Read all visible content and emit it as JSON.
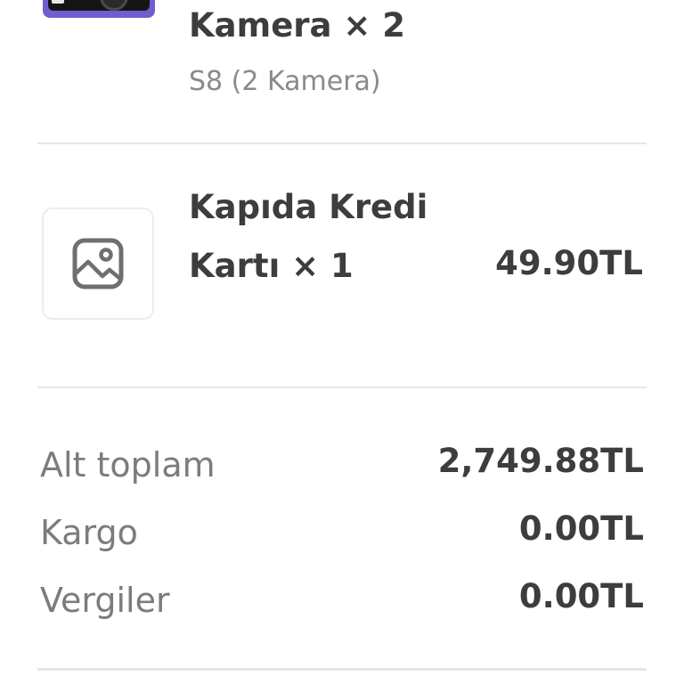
{
  "items": [
    {
      "name": "Kamera × 2",
      "variant": "S8 (2 Kamera)",
      "thumbnail_icon": "camera-product-photo"
    },
    {
      "name_line1": "Kapıda Kredi",
      "name_line2": "Kartı × 1",
      "price": "49.90TL",
      "thumbnail_icon": "image-placeholder-icon"
    }
  ],
  "totals": {
    "subtotal_label": "Alt toplam",
    "subtotal_value": "2,749.88TL",
    "shipping_label": "Kargo",
    "shipping_value": "0.00TL",
    "taxes_label": "Vergiler",
    "taxes_value": "0.00TL"
  },
  "colors": {
    "text_primary": "#3d3d3d",
    "text_secondary": "#8a8a8a",
    "divider": "#e6e6e6",
    "thumbnail_accent": "#6e5fd0"
  }
}
